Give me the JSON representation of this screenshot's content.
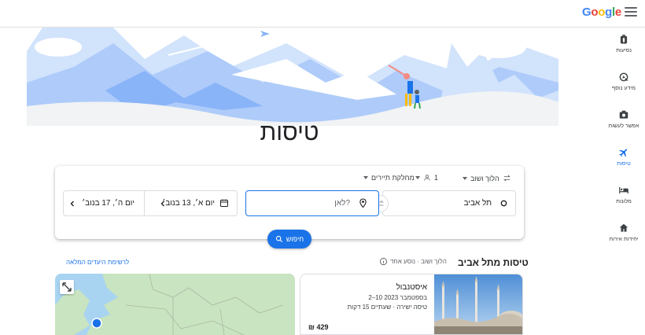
{
  "brand": {
    "logo_letters": [
      "G",
      "o",
      "o",
      "g",
      "l",
      "e"
    ],
    "logo_colors": [
      "#4285f4",
      "#ea4335",
      "#fbbc05",
      "#4285f4",
      "#34a853",
      "#ea4335"
    ]
  },
  "rail": {
    "items": [
      {
        "label": "נסיעות",
        "icon": "suitcase-icon"
      },
      {
        "label": "מידע נוסף",
        "icon": "explore-icon"
      },
      {
        "label": "אפשר לעשות",
        "icon": "camera-icon"
      },
      {
        "label": "טיסות",
        "icon": "plane-icon",
        "active": true
      },
      {
        "label": "מלונות",
        "icon": "bed-icon"
      },
      {
        "label": "יחידות אירוח",
        "icon": "house-icon"
      }
    ]
  },
  "page_title": "טיסות",
  "search": {
    "trip_type": "הלוך ושוב",
    "passengers": "1",
    "cabin_class": "מחלקת תיירים",
    "origin": "תל אביב",
    "destination_placeholder": "לאן?",
    "depart_date": "יום א׳, 13 בנוב׳",
    "return_date": "יום ה׳, 17 בנוב׳",
    "search_label": "חיפוש"
  },
  "section": {
    "title": "טיסות מתל אביב",
    "subtitle": "הלוך ושוב · נוסע אחד",
    "full_list_link": "לרשימת היעדים המלאה"
  },
  "destinations": [
    {
      "name": "איסטנבול",
      "dates": "2–10 בספטמבר 2023",
      "info": "טיסה ישירה · שעתיים 15 דקות",
      "price": "₪ 429"
    }
  ],
  "colors": {
    "accent": "#1a73e8",
    "map_water": "#a8d4f2",
    "map_land": "#c9e4c0"
  }
}
